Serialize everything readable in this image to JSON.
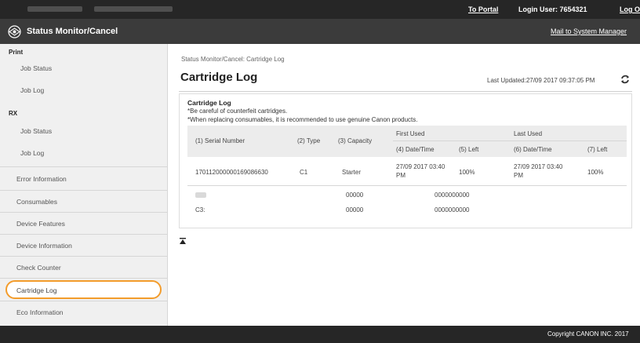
{
  "topbar": {
    "portal_link": "To Portal",
    "login_user": "Login User:  7654321",
    "logout_link": "Log Out"
  },
  "titlebar": {
    "logo_icon": "status-monitor-logo-icon",
    "title": "Status Monitor/Cancel",
    "mail_link": "Mail to System Manager"
  },
  "sidebar": {
    "print_heading": "Print",
    "rx_heading": "RX",
    "print_items": [
      "Job Status",
      "Job Log"
    ],
    "rx_items": [
      "Job Status",
      "Job Log"
    ],
    "items": [
      "Error Information",
      "Consumables",
      "Device Features",
      "Device Information",
      "Check Counter",
      "Cartridge Log",
      "Eco Information"
    ],
    "selected": "Cartridge Log",
    "highlight_color": "#f39c2b"
  },
  "main": {
    "breadcrumb": "Status Monitor/Cancel: Cartridge Log",
    "title": "Cartridge Log",
    "last_updated": "Last Updated:27/09 2017 09:37:05 PM",
    "refresh_icon": "refresh-icon"
  },
  "panel": {
    "title": "Cartridge Log",
    "note1": "*Be careful of counterfeit cartridges.",
    "note2": "*When replacing consumables, it is recommended to use genuine Canon products.",
    "headers": {
      "serial": "(1) Serial Number",
      "type": "(2) Type",
      "capacity": "(3) Capacity",
      "first_used": "First Used",
      "last_used": "Last Used",
      "first_datetime": "(4) Date/Time",
      "first_left": "(5) Left",
      "last_datetime": "(6) Date/Time",
      "last_left": "(7) Left"
    },
    "row": {
      "serial": "170112000000169086630",
      "type": "C1",
      "capacity": "Starter",
      "first_datetime_1": "27/09 2017 03:40",
      "first_datetime_2": "PM",
      "first_left": "100%",
      "last_datetime_1": "27/09 2017 03:40",
      "last_datetime_2": "PM",
      "last_left": "100%"
    },
    "summary": [
      {
        "label": "",
        "capacity": "00000",
        "value": "0000000000"
      },
      {
        "label": "C3:",
        "capacity": "00000",
        "value": "0000000000"
      }
    ]
  },
  "scroll_top_icon": "scroll-to-top-icon",
  "footer": {
    "copyright": "Copyright CANON INC. 2017"
  }
}
